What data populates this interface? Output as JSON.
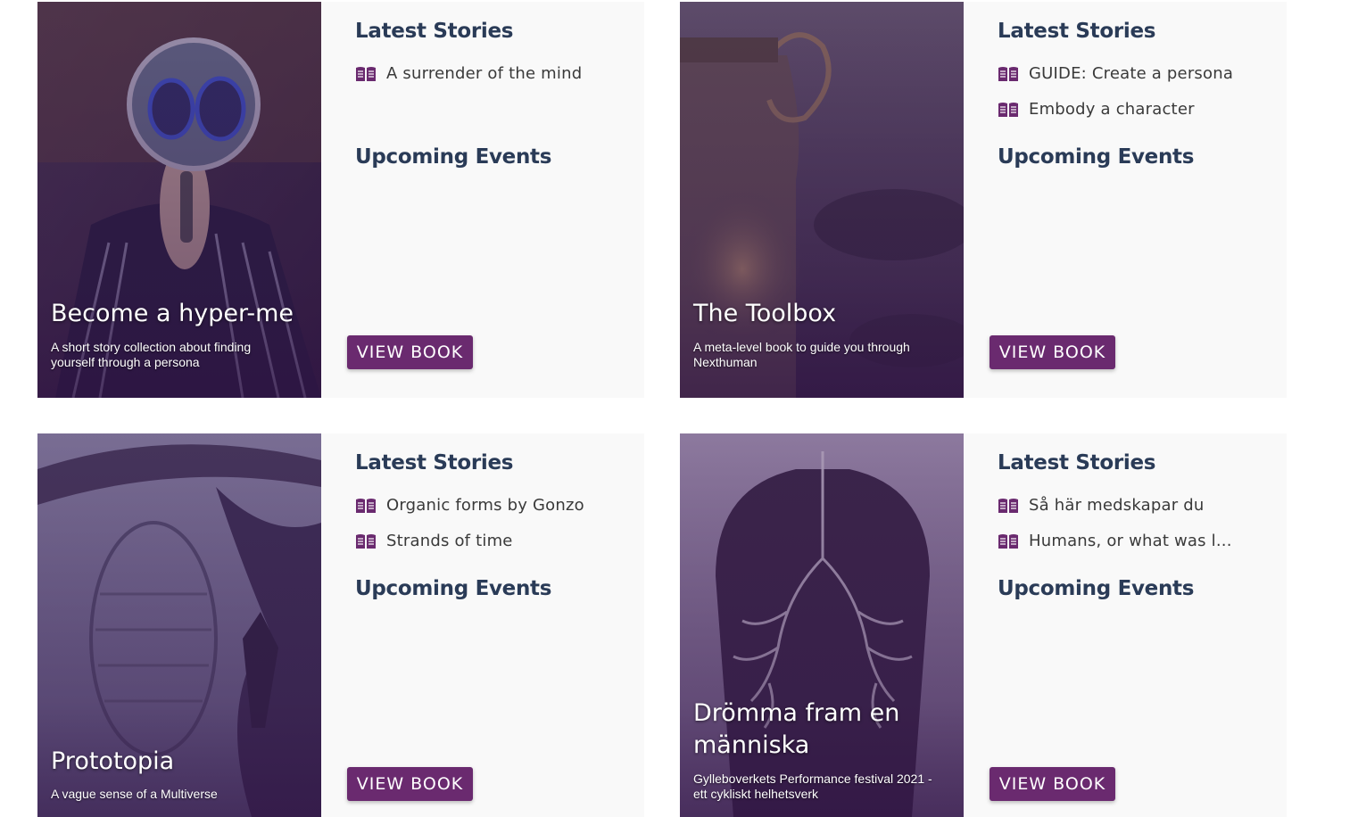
{
  "accent_color": "#6a2a6f",
  "heading_color": "#2a3b57",
  "books": [
    {
      "title": "Become a hyper-me",
      "subtitle": "A short story collection about finding yourself through a persona",
      "latest_heading": "Latest Stories",
      "stories": [
        "A surrender of the mind"
      ],
      "events_heading": "Upcoming Events",
      "button_label": "VIEW BOOK",
      "story_icon": "book-open-icon"
    },
    {
      "title": "The Toolbox",
      "subtitle": "A meta-level book to guide you through Nexthuman",
      "latest_heading": "Latest Stories",
      "stories": [
        "GUIDE: Create a persona",
        "Embody a character"
      ],
      "events_heading": "Upcoming Events",
      "button_label": "VIEW BOOK",
      "story_icon": "book-open-icon"
    },
    {
      "title": "Prototopia",
      "subtitle": "A vague sense of a Multiverse",
      "latest_heading": "Latest Stories",
      "stories": [
        "Organic forms by Gonzo",
        "Strands of time"
      ],
      "events_heading": "Upcoming Events",
      "button_label": "VIEW BOOK",
      "story_icon": "book-open-icon"
    },
    {
      "title": "Drömma fram en människa",
      "subtitle": "Gylleboverkets Performance festival 2021 - ett cykliskt helhetsverk",
      "latest_heading": "Latest Stories",
      "stories": [
        "Så här medskapar du",
        "Humans, or what was l..."
      ],
      "events_heading": "Upcoming Events",
      "button_label": "VIEW BOOK",
      "story_icon": "book-open-icon"
    }
  ]
}
